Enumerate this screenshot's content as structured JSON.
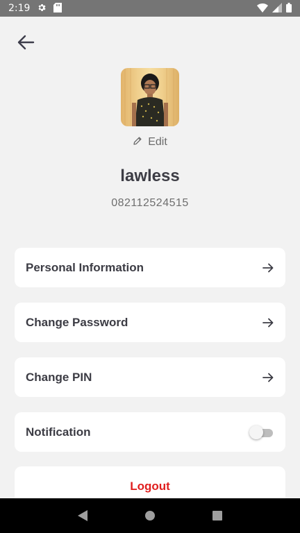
{
  "status_bar": {
    "time": "2:19",
    "icons": [
      "gear-icon",
      "sd-card-icon",
      "wifi-icon",
      "signal-icon",
      "battery-icon"
    ]
  },
  "header": {
    "back_icon": "arrow-left-icon"
  },
  "profile": {
    "edit_label": "Edit",
    "edit_icon": "pencil-icon",
    "username": "lawless",
    "phone": "082112524515"
  },
  "menu": {
    "items": [
      {
        "label": "Personal Information",
        "icon": "arrow-right-icon"
      },
      {
        "label": "Change Password",
        "icon": "arrow-right-icon"
      },
      {
        "label": "Change PIN",
        "icon": "arrow-right-icon"
      },
      {
        "label": "Notification",
        "toggle_on": false
      }
    ],
    "logout_label": "Logout"
  },
  "colors": {
    "background": "#f2f2f2",
    "card": "#ffffff",
    "text_dark": "#3c3c44",
    "logout": "#e01e1e",
    "status_bar": "#757575"
  },
  "nav_bar": {
    "icons": [
      "back-triangle-icon",
      "home-circle-icon",
      "recents-square-icon"
    ]
  }
}
